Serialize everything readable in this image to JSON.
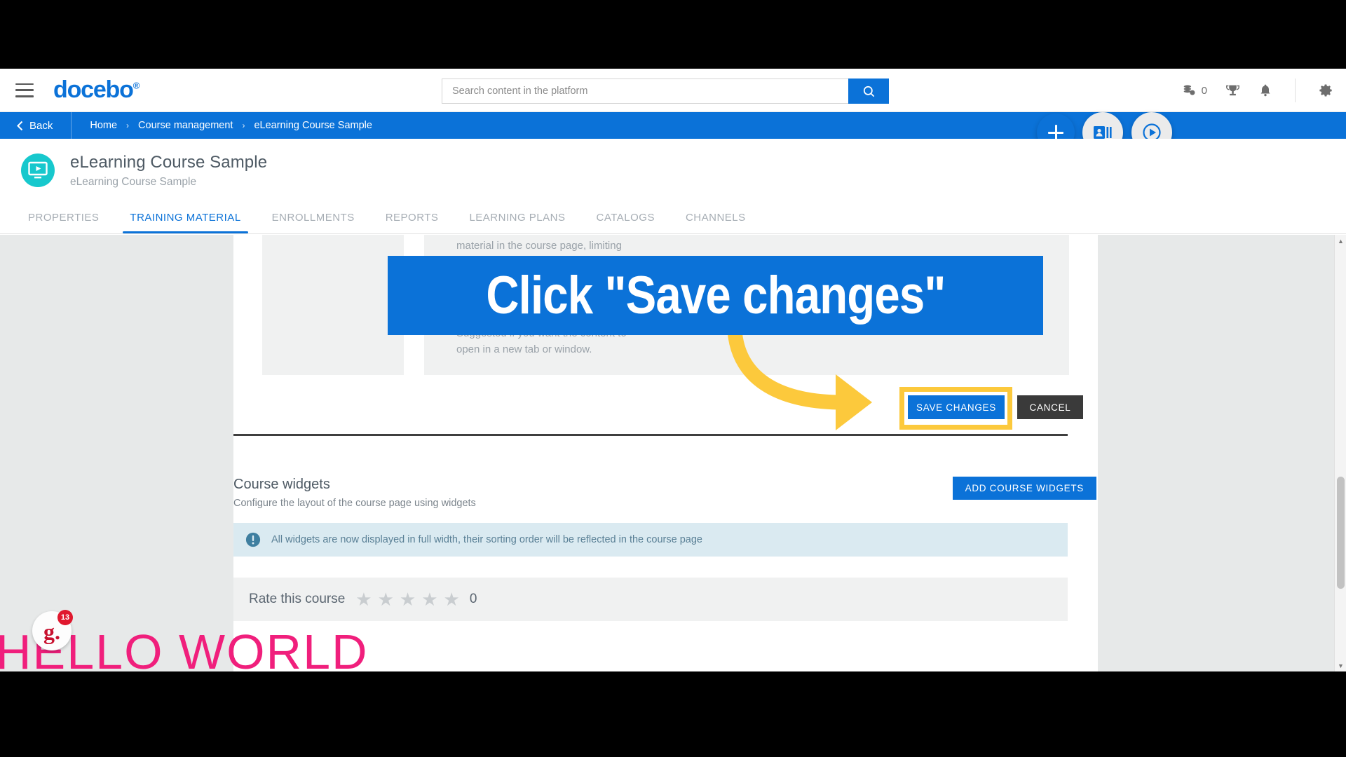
{
  "header": {
    "brand": "docebo",
    "brand_mark": "®",
    "menu_icon": "hamburger-icon",
    "search": {
      "placeholder": "Search content in the platform",
      "value": ""
    },
    "coins_count": "0",
    "icons": [
      "coins-icon",
      "trophy-icon",
      "bell-icon",
      "gear-icon"
    ]
  },
  "breadcrumb": {
    "back_label": "Back",
    "items": [
      "Home",
      "Course management",
      "eLearning Course Sample"
    ],
    "separator": "›"
  },
  "fabs": [
    {
      "name": "add-button",
      "icon": "plus-icon"
    },
    {
      "name": "enrollments-button",
      "icon": "id-card-icon"
    },
    {
      "name": "preview-button",
      "icon": "play-circle-icon"
    }
  ],
  "course": {
    "icon": "monitor-play-icon",
    "title": "eLearning Course Sample",
    "subtitle": "eLearning Course Sample"
  },
  "tabs": [
    {
      "label": "PROPERTIES",
      "active": false
    },
    {
      "label": "TRAINING MATERIAL",
      "active": true
    },
    {
      "label": "ENROLLMENTS",
      "active": false
    },
    {
      "label": "REPORTS",
      "active": false
    },
    {
      "label": "LEARNING PLANS",
      "active": false
    },
    {
      "label": "CATALOGS",
      "active": false
    },
    {
      "label": "CHANNELS",
      "active": false
    }
  ],
  "panel": {
    "option_text_1": "Suggested to play only the training\nmaterial in the course page, limiting",
    "option_text_2": "Suggested if you want the content to\nopen in a new tab or window.",
    "save_label": "SAVE CHANGES",
    "cancel_label": "CANCEL"
  },
  "course_widgets": {
    "title": "Course widgets",
    "subtitle": "Configure the layout of the course page using widgets",
    "add_button": "ADD COURSE WIDGETS",
    "notice": "All widgets are now displayed in full width, their sorting order will be reflected in the course page",
    "notice_icon": "info-icon",
    "rate_label": "Rate this course",
    "rate_value": "0",
    "star_count": 5
  },
  "overlay": {
    "callout_text": "Click \"Save changes\"",
    "arrow_icon": "curved-arrow-right-icon",
    "watermark_text": "HELLO WORLD",
    "logo_letter": "g.",
    "logo_badge": "13"
  },
  "scrollbar": {
    "up": "▲",
    "down": "▼"
  },
  "colors": {
    "brand_blue": "#0b72d8",
    "teal": "#17c8cd",
    "highlight_yellow": "#fcc93c",
    "pink": "#f01f7c",
    "notice_bg": "#daeaf1",
    "cancel_gray": "#3a3a3a"
  }
}
